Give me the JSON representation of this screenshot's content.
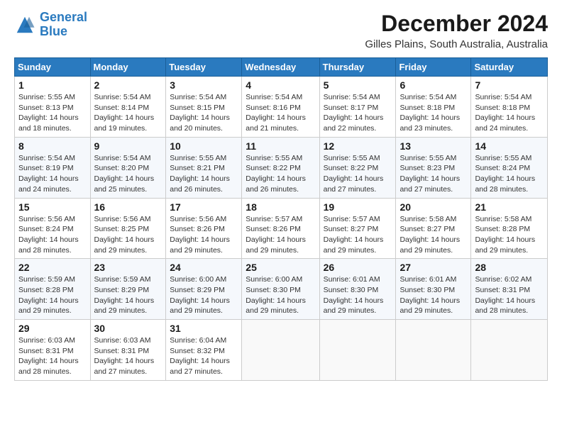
{
  "logo": {
    "line1": "General",
    "line2": "Blue"
  },
  "title": "December 2024",
  "subtitle": "Gilles Plains, South Australia, Australia",
  "days_header": [
    "Sunday",
    "Monday",
    "Tuesday",
    "Wednesday",
    "Thursday",
    "Friday",
    "Saturday"
  ],
  "weeks": [
    [
      {
        "day": "1",
        "sunrise": "5:55 AM",
        "sunset": "8:13 PM",
        "daylight": "14 hours and 18 minutes."
      },
      {
        "day": "2",
        "sunrise": "5:54 AM",
        "sunset": "8:14 PM",
        "daylight": "14 hours and 19 minutes."
      },
      {
        "day": "3",
        "sunrise": "5:54 AM",
        "sunset": "8:15 PM",
        "daylight": "14 hours and 20 minutes."
      },
      {
        "day": "4",
        "sunrise": "5:54 AM",
        "sunset": "8:16 PM",
        "daylight": "14 hours and 21 minutes."
      },
      {
        "day": "5",
        "sunrise": "5:54 AM",
        "sunset": "8:17 PM",
        "daylight": "14 hours and 22 minutes."
      },
      {
        "day": "6",
        "sunrise": "5:54 AM",
        "sunset": "8:18 PM",
        "daylight": "14 hours and 23 minutes."
      },
      {
        "day": "7",
        "sunrise": "5:54 AM",
        "sunset": "8:18 PM",
        "daylight": "14 hours and 24 minutes."
      }
    ],
    [
      {
        "day": "8",
        "sunrise": "5:54 AM",
        "sunset": "8:19 PM",
        "daylight": "14 hours and 24 minutes."
      },
      {
        "day": "9",
        "sunrise": "5:54 AM",
        "sunset": "8:20 PM",
        "daylight": "14 hours and 25 minutes."
      },
      {
        "day": "10",
        "sunrise": "5:55 AM",
        "sunset": "8:21 PM",
        "daylight": "14 hours and 26 minutes."
      },
      {
        "day": "11",
        "sunrise": "5:55 AM",
        "sunset": "8:22 PM",
        "daylight": "14 hours and 26 minutes."
      },
      {
        "day": "12",
        "sunrise": "5:55 AM",
        "sunset": "8:22 PM",
        "daylight": "14 hours and 27 minutes."
      },
      {
        "day": "13",
        "sunrise": "5:55 AM",
        "sunset": "8:23 PM",
        "daylight": "14 hours and 27 minutes."
      },
      {
        "day": "14",
        "sunrise": "5:55 AM",
        "sunset": "8:24 PM",
        "daylight": "14 hours and 28 minutes."
      }
    ],
    [
      {
        "day": "15",
        "sunrise": "5:56 AM",
        "sunset": "8:24 PM",
        "daylight": "14 hours and 28 minutes."
      },
      {
        "day": "16",
        "sunrise": "5:56 AM",
        "sunset": "8:25 PM",
        "daylight": "14 hours and 29 minutes."
      },
      {
        "day": "17",
        "sunrise": "5:56 AM",
        "sunset": "8:26 PM",
        "daylight": "14 hours and 29 minutes."
      },
      {
        "day": "18",
        "sunrise": "5:57 AM",
        "sunset": "8:26 PM",
        "daylight": "14 hours and 29 minutes."
      },
      {
        "day": "19",
        "sunrise": "5:57 AM",
        "sunset": "8:27 PM",
        "daylight": "14 hours and 29 minutes."
      },
      {
        "day": "20",
        "sunrise": "5:58 AM",
        "sunset": "8:27 PM",
        "daylight": "14 hours and 29 minutes."
      },
      {
        "day": "21",
        "sunrise": "5:58 AM",
        "sunset": "8:28 PM",
        "daylight": "14 hours and 29 minutes."
      }
    ],
    [
      {
        "day": "22",
        "sunrise": "5:59 AM",
        "sunset": "8:28 PM",
        "daylight": "14 hours and 29 minutes."
      },
      {
        "day": "23",
        "sunrise": "5:59 AM",
        "sunset": "8:29 PM",
        "daylight": "14 hours and 29 minutes."
      },
      {
        "day": "24",
        "sunrise": "6:00 AM",
        "sunset": "8:29 PM",
        "daylight": "14 hours and 29 minutes."
      },
      {
        "day": "25",
        "sunrise": "6:00 AM",
        "sunset": "8:30 PM",
        "daylight": "14 hours and 29 minutes."
      },
      {
        "day": "26",
        "sunrise": "6:01 AM",
        "sunset": "8:30 PM",
        "daylight": "14 hours and 29 minutes."
      },
      {
        "day": "27",
        "sunrise": "6:01 AM",
        "sunset": "8:30 PM",
        "daylight": "14 hours and 29 minutes."
      },
      {
        "day": "28",
        "sunrise": "6:02 AM",
        "sunset": "8:31 PM",
        "daylight": "14 hours and 28 minutes."
      }
    ],
    [
      {
        "day": "29",
        "sunrise": "6:03 AM",
        "sunset": "8:31 PM",
        "daylight": "14 hours and 28 minutes."
      },
      {
        "day": "30",
        "sunrise": "6:03 AM",
        "sunset": "8:31 PM",
        "daylight": "14 hours and 27 minutes."
      },
      {
        "day": "31",
        "sunrise": "6:04 AM",
        "sunset": "8:32 PM",
        "daylight": "14 hours and 27 minutes."
      },
      null,
      null,
      null,
      null
    ]
  ]
}
